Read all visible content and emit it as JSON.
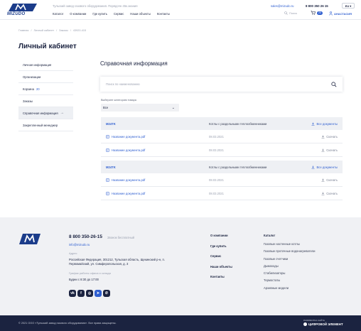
{
  "header": {
    "logo_text": "MIZUDO",
    "tagline": "Тульский завод газового оборудования. Порядочн 45к.знания",
    "nav": [
      "Каталог",
      "О компании",
      "Где купить",
      "Сервис",
      "Наши объекты",
      "Контакты"
    ],
    "email": "sales@mizudo.ru",
    "phone": "8 800 350 26 15",
    "lang": "EU",
    "search_label": "Поиск",
    "cart_count": "20",
    "user_name": "АНАСТАСИЯ"
  },
  "breadcrumbs": [
    "Главная",
    "Личный кабинет",
    "Заказы",
    "43920-415"
  ],
  "page_title": "Личный кабинет",
  "sidebar": {
    "items": [
      {
        "label": "Личная информация",
        "count": ""
      },
      {
        "label": "Организации",
        "count": ""
      },
      {
        "label": "Корзина",
        "count": "20"
      },
      {
        "label": "Заказы",
        "count": ""
      },
      {
        "label": "Справочная информация",
        "count": ""
      },
      {
        "label": "Закрепленный менеджер",
        "count": ""
      }
    ],
    "active_index": 4
  },
  "main": {
    "section_title": "Справочная информация",
    "search_placeholder": "Поиск по наименованию",
    "category_label": "Выберите категорию товара",
    "category_value": "Все",
    "groups": [
      {
        "model": "M24TK",
        "description": "Котлы с раздельными теплообменниками",
        "all_docs": "Все документы",
        "docs": [
          {
            "name": "Название документа.pdf",
            "date": "08.03.2021",
            "action": "Скачать"
          },
          {
            "name": "Название документа.pdf",
            "date": "08.03.2021",
            "action": "Скачать"
          }
        ]
      },
      {
        "model": "M24TK",
        "description": "Котлы с раздельными теплообменниками",
        "all_docs": "Все документы",
        "docs": [
          {
            "name": "Название документа.pdf",
            "date": "08.03.2021",
            "action": "Скачать"
          },
          {
            "name": "Название документа.pdf",
            "date": "08.03.2021",
            "action": "Скачать"
          }
        ]
      }
    ]
  },
  "footer": {
    "phone": "8 800 350-26-15",
    "phone_note": "Звонок бесплатный",
    "email": "info@mizudo.ru",
    "address_label": "Адрес",
    "address": "Российская Федерация, 301212, Тульская область, Щекинский р-н, п. Первомайский, ул. Симферопольская, д. 3",
    "hours_label": "График работы офиса и склада",
    "hours": "Будни с 8:30 до 17:00",
    "links": [
      "О компании",
      "Где купить",
      "Сервис",
      "Наши объекты",
      "Контакты"
    ],
    "catalog_title": "Каталог",
    "catalog": [
      "Газовые настенные котлы",
      "Газовые проточные водонагреватели",
      "Газовые счетчики",
      "Дымоходы",
      "Стабилизаторы",
      "Термостаты",
      "Архивные модели"
    ],
    "socials": [
      "vk-icon",
      "facebook-icon",
      "instagram-icon",
      "telegram-icon",
      "whatsapp-icon"
    ],
    "copyright": "© 2021 ООО «Тульский завод газового оборудования». Все права защищены.",
    "developer_label": "РАЗРАБОТКА САЙТА",
    "developer_name": "ЦИФРОВОЙ ЭЛЕМЕНТ"
  },
  "colors": {
    "accent": "#2f5fd0",
    "text": "#1b2340",
    "footer_bg": "#f0f1f4",
    "bottom_bar": "#1b2340"
  }
}
